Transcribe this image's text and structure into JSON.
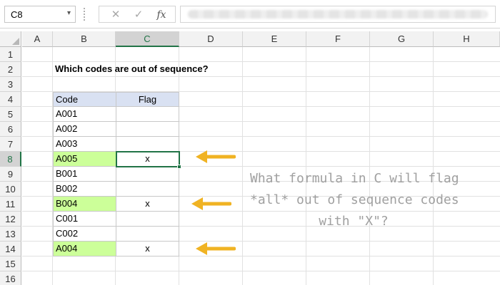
{
  "formula_bar": {
    "name_box": "C8",
    "name_box_arrow": "▾",
    "cancel_symbol": "✕",
    "enter_symbol": "✓",
    "fx_symbol": "fx"
  },
  "columns": [
    "A",
    "B",
    "C",
    "D",
    "E",
    "F",
    "G",
    "H"
  ],
  "rows": [
    "1",
    "2",
    "3",
    "4",
    "5",
    "6",
    "7",
    "8",
    "9",
    "10",
    "11",
    "12",
    "13",
    "14",
    "15",
    "16"
  ],
  "selection": {
    "cell": "C8",
    "column": "C",
    "row": "8"
  },
  "sheet": {
    "title": "Which codes are out of sequence?",
    "table": {
      "headers": {
        "code": "Code",
        "flag": "Flag"
      },
      "rows": [
        {
          "code": "A001",
          "flag": "",
          "highlight": false
        },
        {
          "code": "A002",
          "flag": "",
          "highlight": false
        },
        {
          "code": "A003",
          "flag": "",
          "highlight": false
        },
        {
          "code": "A005",
          "flag": "x",
          "highlight": true
        },
        {
          "code": "B001",
          "flag": "",
          "highlight": false
        },
        {
          "code": "B002",
          "flag": "",
          "highlight": false
        },
        {
          "code": "B004",
          "flag": "x",
          "highlight": true
        },
        {
          "code": "C001",
          "flag": "",
          "highlight": false
        },
        {
          "code": "C002",
          "flag": "",
          "highlight": false
        },
        {
          "code": "A004",
          "flag": "x",
          "highlight": true
        }
      ]
    },
    "note_lines": [
      "What formula in C will flag",
      "*all* out of sequence codes",
      "with \"X\"?"
    ]
  },
  "colors": {
    "accent": "#217346",
    "highlight": "#ccff99",
    "header_fill": "#d9e1f2",
    "arrow": "#f0b323",
    "note_text": "#a0a0a0"
  }
}
